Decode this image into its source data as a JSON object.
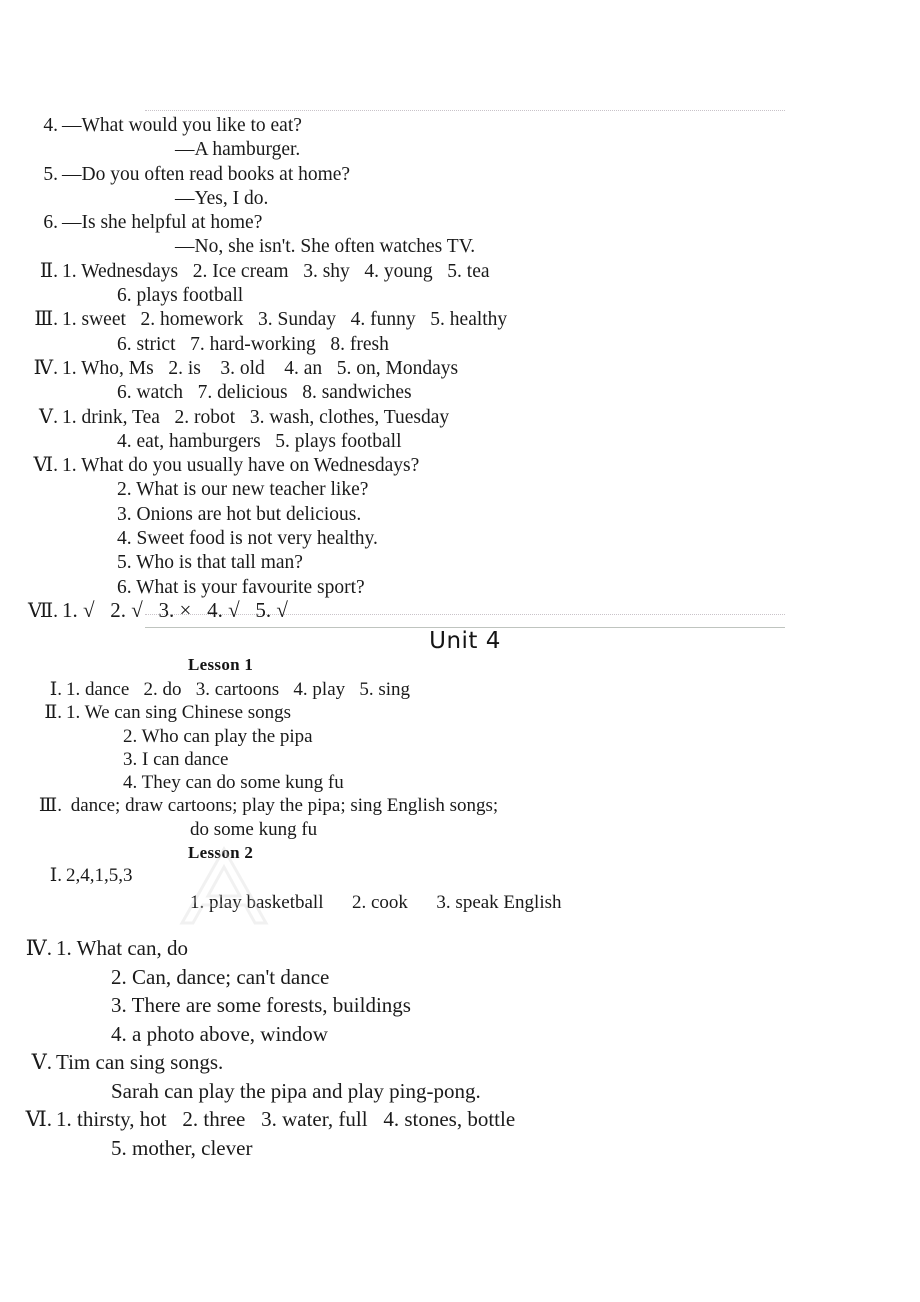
{
  "document": {
    "kind": "answer-key-page",
    "unit_heading": "Unit   4"
  },
  "rules": {
    "top": "",
    "middle_dotted": "",
    "middle_solid": ""
  },
  "section_top": {
    "lines": [
      {
        "num": "4.",
        "text": "—What would you like to eat?"
      },
      {
        "num": "",
        "text": "—A hamburger.",
        "indent": "sub"
      },
      {
        "num": "5.",
        "text": "—Do you often read books at home?"
      },
      {
        "num": "",
        "text": "—Yes, I do.",
        "indent": "sub"
      },
      {
        "num": "6.",
        "text": "—Is she helpful at home?"
      },
      {
        "num": "",
        "text": "—No, she isn't. She often watches TV.",
        "indent": "sub"
      },
      {
        "num": "Ⅱ.",
        "text": "1. Wednesdays   2. Ice cream   3. shy   4. young   5. tea"
      },
      {
        "num": "",
        "text": "6. plays football",
        "indent": "body"
      },
      {
        "num": "Ⅲ.",
        "text": "1. sweet   2. homework   3. Sunday   4. funny   5. healthy"
      },
      {
        "num": "",
        "text": "6. strict   7. hard-working   8. fresh",
        "indent": "body"
      },
      {
        "num": "Ⅳ.",
        "text": "1. Who, Ms   2. is    3. old    4. an   5. on, Mondays"
      },
      {
        "num": "",
        "text": "6. watch   7. delicious   8. sandwiches",
        "indent": "body"
      },
      {
        "num": "Ⅴ.",
        "text": "1. drink, Tea   2. robot   3. wash, clothes, Tuesday"
      },
      {
        "num": "",
        "text": "4. eat, hamburgers   5. plays football",
        "indent": "body"
      },
      {
        "num": "Ⅵ.",
        "text": "1. What do you usually have on Wednesdays?"
      },
      {
        "num": "",
        "text": "2. What is our new teacher like?",
        "indent": "body"
      },
      {
        "num": "",
        "text": "3. Onions are hot but delicious.",
        "indent": "body"
      },
      {
        "num": "",
        "text": "4. Sweet food is not very healthy.",
        "indent": "body"
      },
      {
        "num": "",
        "text": "5. Who is that tall man?",
        "indent": "body"
      },
      {
        "num": "",
        "text": "6. What is your favourite sport?",
        "indent": "body"
      },
      {
        "num": "Ⅶ.",
        "text": "1. √   2. √   3. ×   4. √   5. √",
        "mark": true
      }
    ]
  },
  "lesson_1": {
    "heading": "Lesson  1",
    "lines": [
      {
        "num": "Ⅰ.",
        "text": "1. dance   2. do   3. cartoons   4. play   5. sing"
      },
      {
        "num": "Ⅱ.",
        "text": "1. We can sing Chinese songs"
      },
      {
        "num": "",
        "text": "2. Who can play the pipa",
        "indent": "body"
      },
      {
        "num": "",
        "text": "3. I can dance",
        "indent": "body"
      },
      {
        "num": "",
        "text": "4. They can do some kung fu",
        "indent": "body"
      },
      {
        "num": "Ⅲ.",
        "text": " dance; draw cartoons; play the pipa; sing English songs;"
      },
      {
        "num": "",
        "text": "do some kung fu",
        "indent": "sub3"
      }
    ]
  },
  "lesson_2": {
    "heading": "Lesson  2",
    "lines": [
      {
        "num": "Ⅰ.",
        "text": "2,4,1,5,3"
      },
      {
        "num": "",
        "text": "1. play basketball      2. cook      3. speak English",
        "indent": "sub"
      }
    ]
  },
  "section_bottom": {
    "lines": [
      {
        "num": "Ⅳ.",
        "text": "1. What can, do"
      },
      {
        "num": "",
        "text": "2. Can, dance; can't dance",
        "indent": "body"
      },
      {
        "num": "",
        "text": "3. There are some forests, buildings",
        "indent": "body"
      },
      {
        "num": "",
        "text": "4. a photo above, window",
        "indent": "body"
      },
      {
        "num": "Ⅴ.",
        "text": "Tim can sing songs."
      },
      {
        "num": "",
        "text": "Sarah can play the pipa and play ping-pong.",
        "indent": "body"
      },
      {
        "num": "Ⅵ.",
        "text": "1. thirsty, hot   2. three   3. water, full   4. stones, bottle"
      },
      {
        "num": "",
        "text": "5. mother, clever",
        "indent": "body"
      }
    ]
  },
  "watermark": {
    "glyph": "A",
    "color": "#d7d7d7"
  }
}
